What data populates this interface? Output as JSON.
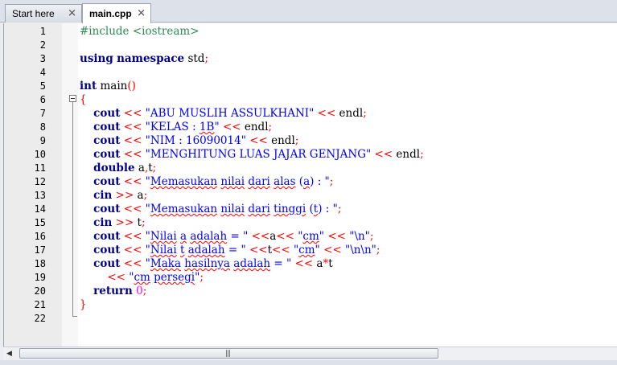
{
  "tabs": [
    {
      "label": "Start here",
      "close": "✕",
      "active": false
    },
    {
      "label": "main.cpp",
      "close": "✕",
      "active": true
    }
  ],
  "editor": {
    "line_numbers": [
      "1",
      "2",
      "3",
      "4",
      "5",
      "6",
      "7",
      "8",
      "9",
      "10",
      "11",
      "12",
      "13",
      "14",
      "15",
      "16",
      "17",
      "18",
      "19",
      "20",
      "21",
      "22"
    ],
    "lines": [
      "#include <iostream>",
      "",
      "using namespace std;",
      "",
      "int main()",
      "{",
      "    cout << \"ABU MUSLIH ASSULKHANI\" << endl;",
      "    cout << \"KELAS : 1B\" << endl;",
      "    cout << \"NIM : 16090014\" << endl;",
      "    cout << \"MENGHITUNG LUAS JAJAR GENJANG\" << endl;",
      "    double a,t;",
      "    cout << \"Memasukan nilai dari alas (a) : \";",
      "    cin >> a;",
      "    cout << \"Memasukan nilai dari tinggi (t) : \";",
      "    cin >> t;",
      "    cout << \"Nilai a adalah = \" <<a<< \"cm\" << \"\\n\";",
      "    cout << \"Nilai t adalah = \" <<t<< \"cm\" << \"\\n\\n\";",
      "    cout << \"Maka hasilnya adalah = \" << a*t",
      "        << \"cm persegi\";",
      "    return 0;",
      "}",
      ""
    ]
  },
  "scrollbar": {
    "left_arrow": "◀",
    "grip": "|||"
  },
  "colors": {
    "keyword": "#00008b",
    "preprocessor": "#2e8b57",
    "string": "#0000ff",
    "operator": "#ff0000",
    "number": "#ff00ff",
    "gutter": "#ececec"
  }
}
